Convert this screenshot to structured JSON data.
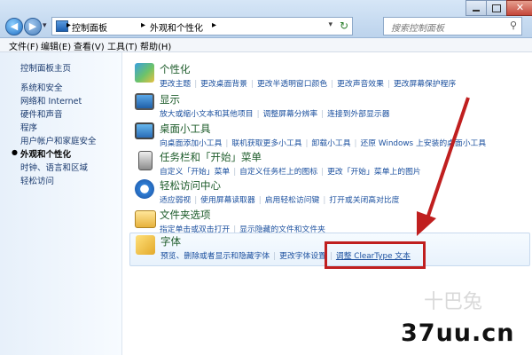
{
  "address": {
    "crumbs": [
      "控制面板",
      "外观和个性化"
    ],
    "search_placeholder": "搜索控制面板"
  },
  "menu": [
    "文件(F)",
    "编辑(E)",
    "查看(V)",
    "工具(T)",
    "帮助(H)"
  ],
  "sidebar": {
    "items": [
      "控制面板主页",
      "系统和安全",
      "网络和 Internet",
      "硬件和声音",
      "程序",
      "用户帐户和家庭安全",
      "外观和个性化",
      "时钟、语言和区域",
      "轻松访问"
    ],
    "current_index": 6
  },
  "categories": [
    {
      "title": "个性化",
      "links": [
        "更改主题",
        "更改桌面背景",
        "更改半透明窗口颜色",
        "更改声音效果",
        "更改屏幕保护程序"
      ]
    },
    {
      "title": "显示",
      "links": [
        "放大或缩小文本和其他项目",
        "调整屏幕分辨率",
        "连接到外部显示器"
      ]
    },
    {
      "title": "桌面小工具",
      "links": [
        "向桌面添加小工具",
        "联机获取更多小工具",
        "卸载小工具",
        "还原 Windows 上安装的桌面小工具"
      ]
    },
    {
      "title": "任务栏和「开始」菜单",
      "links": [
        "自定义「开始」菜单",
        "自定义任务栏上的图标",
        "更改「开始」菜单上的图片"
      ]
    },
    {
      "title": "轻松访问中心",
      "links": [
        "适应弱视",
        "使用屏幕读取器",
        "启用轻松访问键",
        "打开或关闭高对比度"
      ]
    },
    {
      "title": "文件夹选项",
      "links": [
        "指定单击或双击打开",
        "显示隐藏的文件和文件夹"
      ]
    },
    {
      "title": "字体",
      "links": [
        "预览、删除或者显示和隐藏字体",
        "更改字体设置",
        "调整 ClearType 文本"
      ]
    }
  ],
  "watermark": {
    "brand": "37uu.cn",
    "faint": "十巴兔"
  },
  "colors": {
    "highlight": "#c01f1f",
    "link": "#1a4f9e",
    "category_title": "#1d5b2a"
  }
}
